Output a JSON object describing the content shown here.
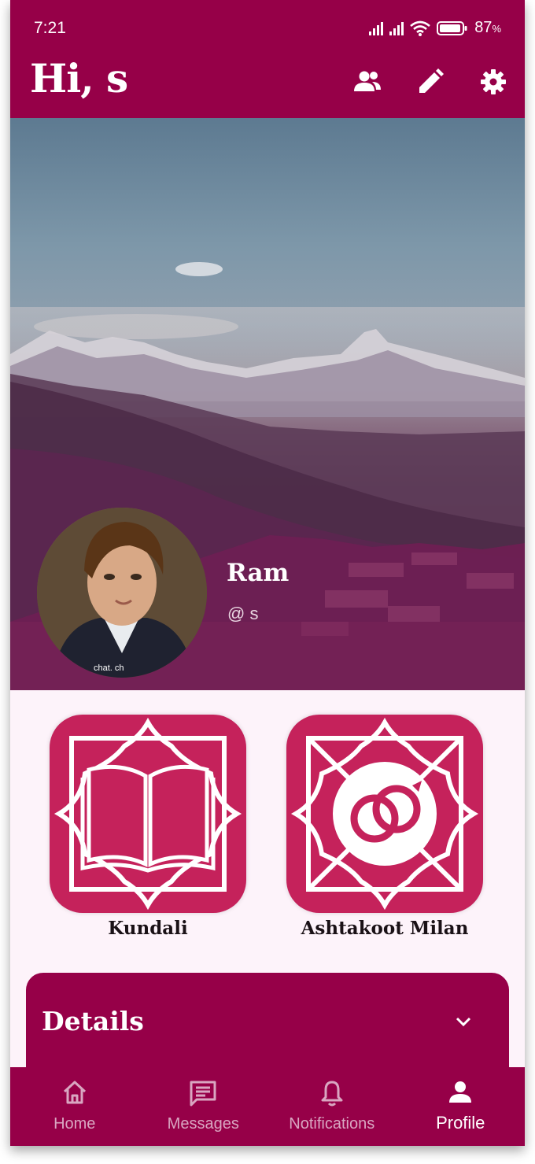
{
  "status_bar": {
    "time": "7:21",
    "battery": "87",
    "battery_unit": "%"
  },
  "header": {
    "greeting": "Hi, s"
  },
  "profile": {
    "name": "Ram",
    "handle": "@ s",
    "avatar_caption": "chat. ch"
  },
  "features": [
    {
      "label": "Kundali",
      "icon": "book-icon"
    },
    {
      "label": "Ashtakoot Milan",
      "icon": "rings-icon"
    }
  ],
  "details": {
    "title": "Details"
  },
  "bottom_nav": [
    {
      "label": "Home",
      "icon": "home-icon"
    },
    {
      "label": "Messages",
      "icon": "messages-icon"
    },
    {
      "label": "Notifications",
      "icon": "bell-icon"
    },
    {
      "label": "Profile",
      "icon": "person-icon"
    }
  ],
  "colors": {
    "primary": "#960048",
    "accent": "#c5225b",
    "background": "#fdf3fa"
  }
}
